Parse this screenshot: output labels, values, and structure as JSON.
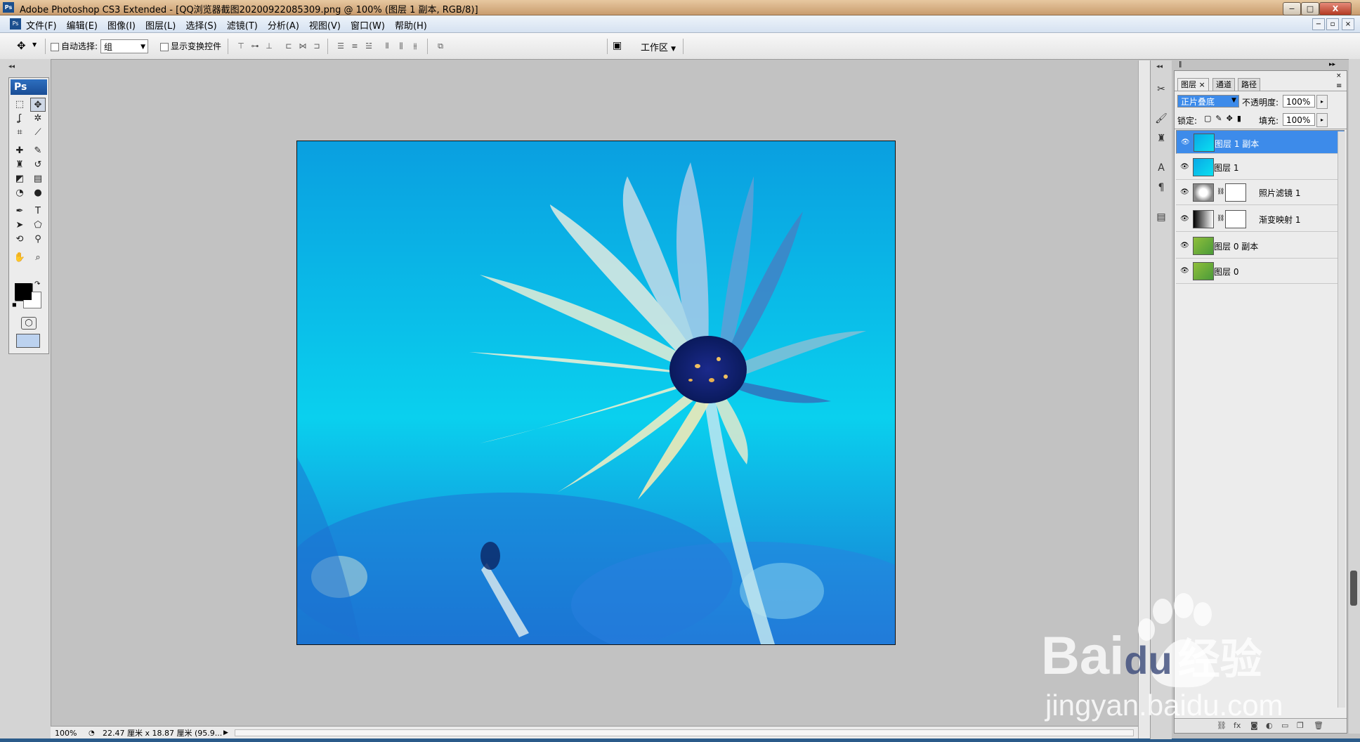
{
  "window": {
    "app_badge": "Ps",
    "title": "Adobe Photoshop CS3 Extended - [QQ浏览器截图20200922085309.png @ 100% (图层 1 副本, RGB/8)]",
    "buttons": {
      "minimize": "−",
      "maximize": "□",
      "close": "X"
    }
  },
  "menu": {
    "app_icon": "Ps",
    "items": [
      "文件(F)",
      "编辑(E)",
      "图像(I)",
      "图层(L)",
      "选择(S)",
      "滤镜(T)",
      "分析(A)",
      "视图(V)",
      "窗口(W)",
      "帮助(H)"
    ],
    "mdi_buttons": {
      "minimize": "−",
      "restore": "▫",
      "close": "×"
    }
  },
  "options_bar": {
    "tool_icon": "move-tool-icon",
    "auto_select_label": "自动选择:",
    "auto_select_value": "组",
    "show_transform_label": "显示变换控件",
    "workspace_label": "工作区",
    "workspace_arrow": "▼"
  },
  "toolbox": {
    "logo": "Ps",
    "tools": [
      {
        "name": "marquee-tool-icon",
        "glyph": "⬚"
      },
      {
        "name": "move-tool-icon",
        "glyph": "✥"
      },
      {
        "name": "lasso-tool-icon",
        "glyph": "ʆ"
      },
      {
        "name": "magic-wand-tool-icon",
        "glyph": "✲"
      },
      {
        "name": "crop-tool-icon",
        "glyph": "⌗"
      },
      {
        "name": "slice-tool-icon",
        "glyph": "⟋"
      },
      {
        "name": "healing-brush-tool-icon",
        "glyph": "✚"
      },
      {
        "name": "brush-tool-icon",
        "glyph": "✎"
      },
      {
        "name": "clone-stamp-tool-icon",
        "glyph": "♜"
      },
      {
        "name": "history-brush-tool-icon",
        "glyph": "↺"
      },
      {
        "name": "eraser-tool-icon",
        "glyph": "◩"
      },
      {
        "name": "gradient-tool-icon",
        "glyph": "▤"
      },
      {
        "name": "blur-tool-icon",
        "glyph": "◔"
      },
      {
        "name": "dodge-tool-icon",
        "glyph": "●"
      },
      {
        "name": "pen-tool-icon",
        "glyph": "✒"
      },
      {
        "name": "type-tool-icon",
        "glyph": "T"
      },
      {
        "name": "path-selection-tool-icon",
        "glyph": "➤"
      },
      {
        "name": "shape-tool-icon",
        "glyph": "⬠"
      },
      {
        "name": "3d-rotate-tool-icon",
        "glyph": "⟲"
      },
      {
        "name": "eyedropper-tool-icon",
        "glyph": "⚲"
      },
      {
        "name": "hand-tool-icon",
        "glyph": "✋"
      },
      {
        "name": "zoom-tool-icon",
        "glyph": "⌕"
      }
    ]
  },
  "colors": {
    "foreground": "#000000",
    "background": "#ffffff",
    "selection": "#3d8bea",
    "canvas_sky_top": "#0a9fe0",
    "canvas_sky_bottom": "#0ad0ee"
  },
  "status_bar": {
    "zoom": "100%",
    "doc_size": "22.47 厘米 x 18.87 厘米 (95.9...",
    "arrow": "▶"
  },
  "layers_panel": {
    "tabs": [
      "图层",
      "通道",
      "路径"
    ],
    "active_tab_close": "×",
    "blend_mode": "正片叠底",
    "opacity_label": "不透明度:",
    "opacity_value": "100%",
    "lock_label": "锁定:",
    "fill_label": "填充:",
    "fill_value": "100%",
    "layers": [
      {
        "name": "图层 1 副本",
        "selected": true,
        "has_mask": false,
        "thumb": "cyan"
      },
      {
        "name": "图层 1",
        "selected": false,
        "has_mask": false,
        "thumb": "cyan"
      },
      {
        "name": "照片滤镜 1",
        "selected": false,
        "has_mask": true,
        "thumb": "filter"
      },
      {
        "name": "渐变映射 1",
        "selected": false,
        "has_mask": true,
        "thumb": "gradient"
      },
      {
        "name": "图层 0 副本",
        "selected": false,
        "has_mask": false,
        "thumb": "green"
      },
      {
        "name": "图层 0",
        "selected": false,
        "has_mask": false,
        "thumb": "green"
      }
    ]
  },
  "watermark": {
    "brand_latin": "Bai",
    "brand_du": "du",
    "brand_cn": "经验",
    "url": "jingyan.baidu.com"
  }
}
